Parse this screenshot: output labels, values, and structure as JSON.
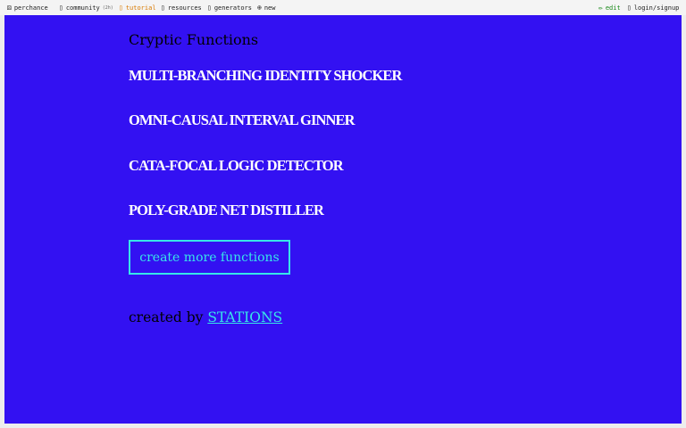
{
  "nav": {
    "logo_icon": "dice-icon",
    "site": "perchance",
    "community_label": "community",
    "community_count": "(2h)",
    "tutorial_label": "tutorial",
    "resources_label": "resources",
    "generators_label": "generators",
    "new_label": "new",
    "edit_label": "edit",
    "login_label": "login/signup"
  },
  "main": {
    "title": "Cryptic Functions",
    "functions": [
      "MULTI-BRANCHING IDENTITY SHOCKER",
      "OMNI-CAUSAL INTERVAL GINNER",
      "CATA-FOCAL LOGIC DETECTOR",
      "POLY-GRADE NET DISTILLER"
    ],
    "button_label": "create more functions",
    "credit_prefix": "created by",
    "credit_link": "STATIONS"
  },
  "colors": {
    "background": "#3311f2",
    "accent": "#37e6e8",
    "function_text": "#ffffff"
  }
}
